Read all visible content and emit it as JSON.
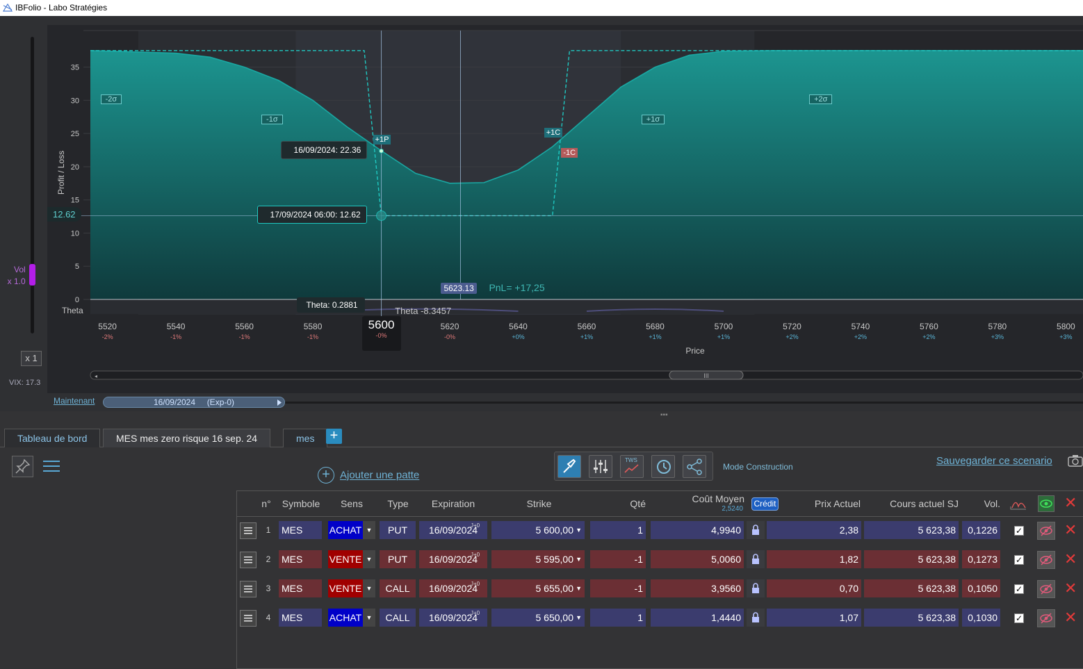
{
  "window": {
    "title": "IBFolio - Labo Stratégies"
  },
  "left_panel": {
    "vol_label": "Vol",
    "vol_mult": "x 1.0",
    "zoom_button": "x 1",
    "vix": "VIX: 17.3"
  },
  "chart_data": {
    "type": "area",
    "ylabel": "Profit / Loss",
    "xlabel": "Price",
    "xlim": [
      5515,
      5805
    ],
    "ylim": [
      0,
      38
    ],
    "x_ticks": [
      5520,
      5540,
      5560,
      5580,
      5600,
      5620,
      5640,
      5660,
      5680,
      5700,
      5720,
      5740,
      5760,
      5780,
      5800
    ],
    "x_tick_labels": [
      "5520",
      "5540",
      "5560",
      "5580",
      "5600",
      "5620",
      "5640",
      "5660",
      "5680",
      "5700",
      "5720",
      "5740",
      "5760",
      "5780",
      "5800"
    ],
    "x_pct_labels": [
      "-2%",
      "-1%",
      "-1%",
      "-1%",
      "-0%",
      "-0%",
      "+0%",
      "+1%",
      "+1%",
      "+1%",
      "+2%",
      "+2%",
      "+2%",
      "+3%",
      "+3%"
    ],
    "y_ticks": [
      0,
      5,
      10,
      15,
      20,
      25,
      30,
      35
    ],
    "series": [
      {
        "key": "today",
        "x": [
          5515,
          5540,
          5550,
          5560,
          5570,
          5580,
          5590,
          5600,
          5610,
          5620,
          5630,
          5640,
          5650,
          5660,
          5670,
          5680,
          5690,
          5700,
          5715,
          5805
        ],
        "y": [
          37.5,
          37.1,
          36.5,
          35,
          33,
          30,
          26,
          22.4,
          19,
          17.5,
          17.6,
          19.5,
          23,
          27.5,
          32,
          35,
          36.8,
          37.4,
          37.5,
          37.5
        ]
      },
      {
        "key": "expiry",
        "x": [
          5515,
          5595,
          5600,
          5650,
          5655,
          5805
        ],
        "y": [
          37.5,
          37.5,
          12.62,
          12.62,
          37.5,
          37.5
        ]
      }
    ],
    "sigma_labels": [
      {
        "text": "-2σ",
        "x": 5520,
        "y": 30
      },
      {
        "text": "-1σ",
        "x": 5567,
        "y": 27
      },
      {
        "text": "+1σ",
        "x": 5676,
        "y": 27
      },
      {
        "text": "+2σ",
        "x": 5725,
        "y": 30
      }
    ],
    "sigma_bands": [
      [
        5529,
        5709
      ],
      [
        5575,
        5670
      ]
    ],
    "leg_markers": [
      {
        "text": "+1P",
        "x": 5600,
        "y": 24,
        "color": "#1f6f7a"
      },
      {
        "text": "+1C",
        "x": 5650,
        "y": 25,
        "color": "#1f6f7a"
      },
      {
        "text": "-1C",
        "x": 5655,
        "y": 22,
        "color": "#b55a5a"
      }
    ],
    "tooltips": {
      "today": "16/09/2024: 22.36",
      "expiry": "17/09/2024 06:00: 12.62",
      "y_cursor": "12.62",
      "spot": "5623.13",
      "pnl": "PnL= +17,25",
      "x_cursor": "5600",
      "x_cursor_pct": "-0%",
      "theta_label": "Theta",
      "theta_point": "Theta: 0.2881",
      "theta_total": "Theta -8.3457"
    },
    "cursor_x": 5600,
    "spot_x": 5623.13,
    "grid": true
  },
  "timeline": {
    "now_link": "Maintenant",
    "date_label": "16/09/2024",
    "exp_label": "(Exp-0)"
  },
  "tabs": [
    {
      "label": "Tableau de bord"
    },
    {
      "label": "MES mes zero risque 16 sep. 24"
    },
    {
      "label": "mes"
    }
  ],
  "toolbar": {
    "add_leg": "Ajouter une patte",
    "mode": "Mode Construction",
    "save": "Sauvegarder ce scenario",
    "tws": "TWS"
  },
  "table": {
    "headers": {
      "n": "n°",
      "symbol": "Symbole",
      "sens": "Sens",
      "type": "Type",
      "expiration": "Expiration",
      "strike": "Strike",
      "qty": "Qté",
      "cost": "Coût Moyen",
      "cost_sub": "2,5240",
      "credit": "Crédit",
      "price": "Prix Actuel",
      "spot": "Cours actuel SJ",
      "vol": "Vol."
    },
    "rows": [
      {
        "n": "1",
        "symbol": "MES",
        "sens": "ACHAT",
        "type": "PUT",
        "j": "J+0",
        "expiration": "16/09/2024",
        "strike": "5 600,00",
        "qty": "1",
        "cost": "4,9940",
        "price": "2,38",
        "spot": "5 623,38",
        "vol": "0,1226",
        "side": "buy"
      },
      {
        "n": "2",
        "symbol": "MES",
        "sens": "VENTE",
        "type": "PUT",
        "j": "J+0",
        "expiration": "16/09/2024",
        "strike": "5 595,00",
        "qty": "-1",
        "cost": "5,0060",
        "price": "1,82",
        "spot": "5 623,38",
        "vol": "0,1273",
        "side": "sell"
      },
      {
        "n": "3",
        "symbol": "MES",
        "sens": "VENTE",
        "type": "CALL",
        "j": "J+0",
        "expiration": "16/09/2024",
        "strike": "5 655,00",
        "qty": "-1",
        "cost": "3,9560",
        "price": "0,70",
        "spot": "5 623,38",
        "vol": "0,1050",
        "side": "sell"
      },
      {
        "n": "4",
        "symbol": "MES",
        "sens": "ACHAT",
        "type": "CALL",
        "j": "J+0",
        "expiration": "16/09/2024",
        "strike": "5 650,00",
        "qty": "1",
        "cost": "1,4440",
        "price": "1,07",
        "spot": "5 623,38",
        "vol": "0,1030",
        "side": "buy"
      }
    ]
  },
  "colors": {
    "accent": "#2a9d9a",
    "fill": "#1f8d8a",
    "buy": "#0000c8",
    "sell": "#a00000",
    "link": "#6fb3d6"
  }
}
